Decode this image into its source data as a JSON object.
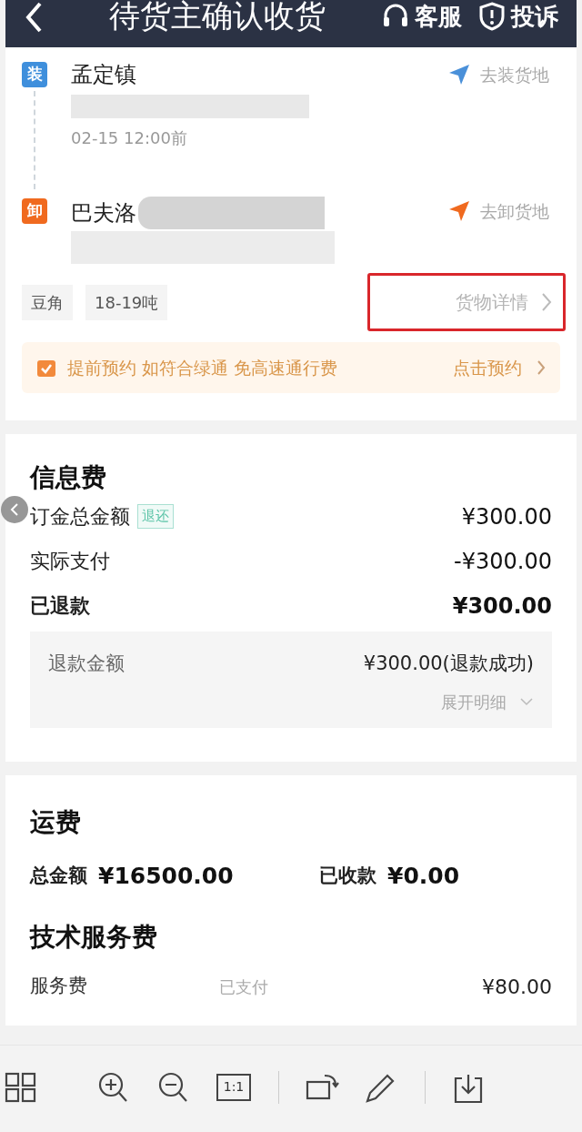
{
  "header": {
    "title": "待货主确认收货",
    "actions": [
      "客服",
      "投诉"
    ]
  },
  "route": {
    "stops": [
      {
        "kind": "load",
        "badge": "装",
        "place": "孟定镇",
        "time": "02-15 12:00前",
        "action": "去装货地"
      },
      {
        "kind": "unload",
        "badge": "卸",
        "place": "巴夫洛",
        "action": "去卸货地"
      }
    ]
  },
  "cargo": {
    "tags": [
      "豆角",
      "18-19吨"
    ],
    "detail_link": "货物详情",
    "highlighted": true
  },
  "promo": {
    "text": "提前预约 如符合绿通 免高速通行费",
    "action": "点击预约"
  },
  "info_fee": {
    "title": "信息费",
    "rows": [
      {
        "label": "订金总金额",
        "tag": "退还",
        "value": "¥300.00",
        "bold": false
      },
      {
        "label": "实际支付",
        "value": "-¥300.00",
        "bold": false
      },
      {
        "label": "已退款",
        "value": "¥300.00",
        "bold": true
      }
    ],
    "refund": {
      "label": "退款金额",
      "value": "¥300.00(退款成功)",
      "toggle": "展开明细"
    }
  },
  "freight": {
    "title": "运费",
    "items": [
      {
        "label": "总金额",
        "value": "¥16500.00"
      },
      {
        "label": "已收款",
        "value": "¥0.00"
      }
    ]
  },
  "service_fee": {
    "title": "技术服务费",
    "rows": [
      {
        "label": "服务费",
        "status": "已支付",
        "value": "¥80.00"
      }
    ]
  },
  "viewer_toolbar": {
    "ratio_label": "1:1"
  }
}
